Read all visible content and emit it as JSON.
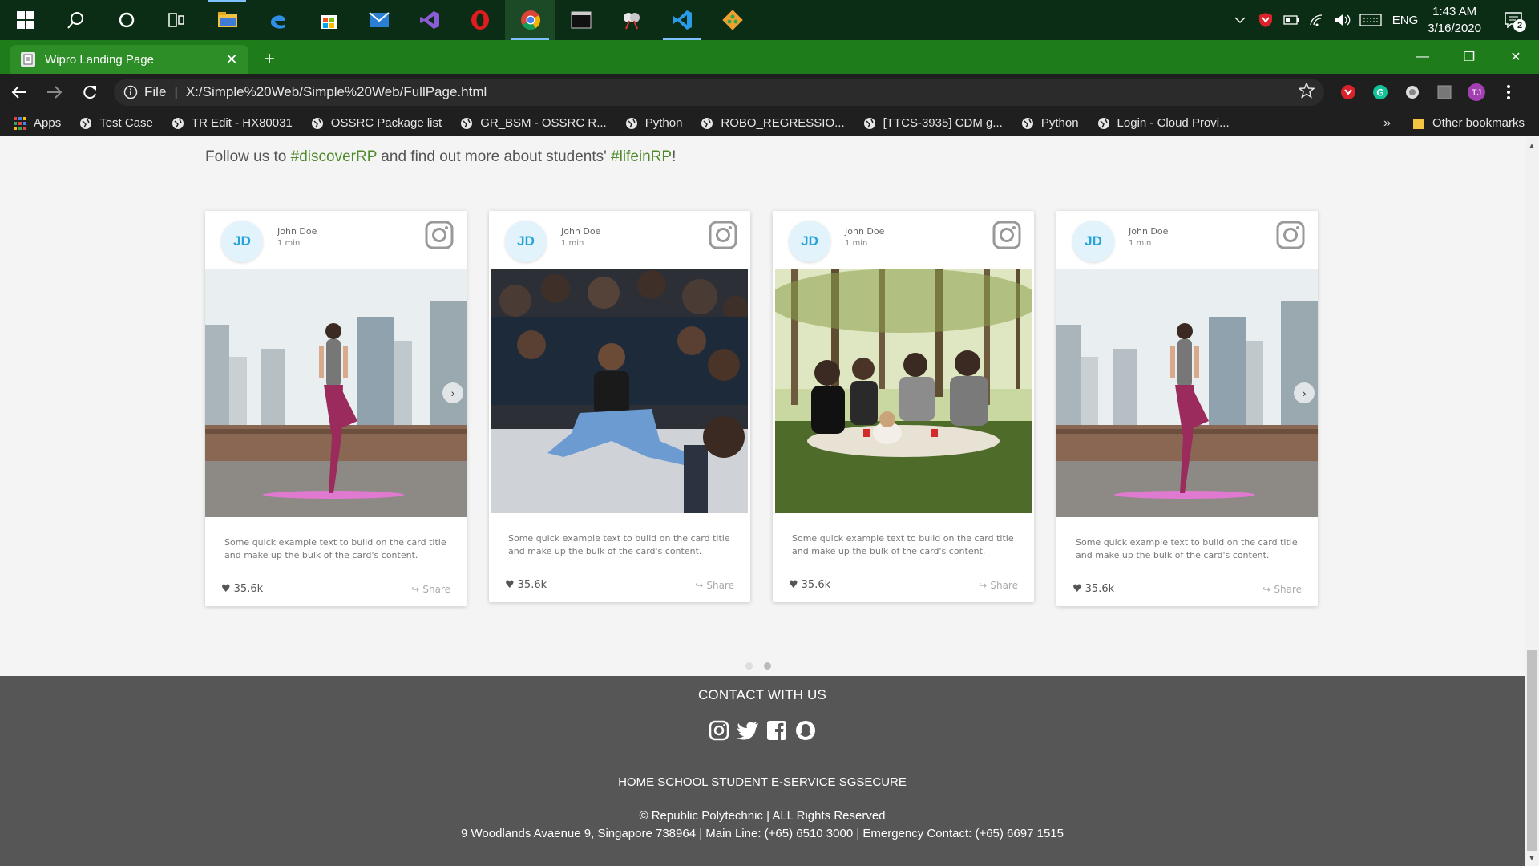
{
  "taskbar": {
    "apps": [
      {
        "name": "start-button"
      },
      {
        "name": "search-button"
      },
      {
        "name": "cortana-button"
      },
      {
        "name": "task-view-button"
      },
      {
        "name": "file-explorer"
      },
      {
        "name": "edge-browser"
      },
      {
        "name": "microsoft-store"
      },
      {
        "name": "mail"
      },
      {
        "name": "visual-studio"
      },
      {
        "name": "opera"
      },
      {
        "name": "chrome"
      },
      {
        "name": "terminal"
      },
      {
        "name": "paint-app"
      },
      {
        "name": "vscode"
      },
      {
        "name": "git-app"
      }
    ],
    "tray": {
      "language": "ENG",
      "time": "1:43 AM",
      "date": "3/16/2020",
      "notification_count": "2"
    }
  },
  "browser": {
    "tab_title": "Wipro Landing Page",
    "url_prefix": "File",
    "url": "X:/Simple%20Web/Simple%20Web/FullPage.html",
    "bookmarks": [
      {
        "label": "Apps"
      },
      {
        "label": "Test Case"
      },
      {
        "label": "TR Edit - HX80031"
      },
      {
        "label": "OSSRC Package list"
      },
      {
        "label": "GR_BSM - OSSRC R..."
      },
      {
        "label": "Python"
      },
      {
        "label": "ROBO_REGRESSIO..."
      },
      {
        "label": "[TTCS-3935] CDM g..."
      },
      {
        "label": "Python"
      },
      {
        "label": "Login - Cloud Provi..."
      }
    ],
    "bookmarks_more": "»",
    "other_bookmarks": "Other bookmarks"
  },
  "page": {
    "follow_prefix": "Follow us to ",
    "hashtag1": "#discoverRP",
    "follow_middle": " and find out more about students' ",
    "hashtag2": "#lifeinRP",
    "follow_suffix": "!",
    "cards": [
      {
        "initials": "JD",
        "name": "John Doe",
        "time": "1 min",
        "text": "Some quick example text to build on the card title and make up the bulk of the card's content.",
        "likes": "35.6k",
        "share": "Share"
      },
      {
        "initials": "JD",
        "name": "John Doe",
        "time": "1 min",
        "text": "Some quick example text to build on the card title and make up the bulk of the card's content.",
        "likes": "35.6k",
        "share": "Share"
      },
      {
        "initials": "JD",
        "name": "John Doe",
        "time": "1 min",
        "text": "Some quick example text to build on the card title and make up the bulk of the card's content.",
        "likes": "35.6k",
        "share": "Share"
      },
      {
        "initials": "JD",
        "name": "John Doe",
        "time": "1 min",
        "text": "Some quick example text to build on the card title and make up the bulk of the card's content.",
        "likes": "35.6k",
        "share": "Share"
      }
    ],
    "carousel_pages": 2,
    "carousel_active": 2
  },
  "footer": {
    "title": "CONTACT WITH US",
    "social": [
      "instagram-icon",
      "twitter-icon",
      "facebook-icon",
      "snapchat-icon"
    ],
    "links": "HOME SCHOOL STUDENT E-SERVICE SGSECURE",
    "copyright": "© Republic Polytechnic | ALL Rights Reserved",
    "address": "9 Woodlands Avaenue 9, Singapore 738964 | Main Line: (+65) 6510 3000 | Emergency Contact: (+65) 6697 1515"
  },
  "colors": {
    "taskbar": "#0b2d15",
    "tabstrip": "#1e7c1a",
    "hashtag": "#4e8a2a",
    "footer": "#565656",
    "avatar_text": "#26a3d8"
  }
}
